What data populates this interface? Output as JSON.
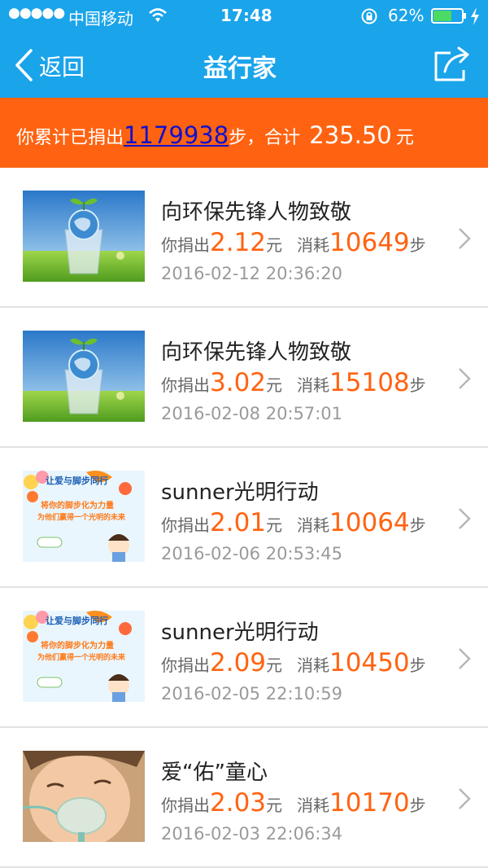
{
  "status_bar": {
    "signal_dots": "●●●●●",
    "carrier": "中国移动",
    "time": "17:48",
    "battery": "62%"
  },
  "nav": {
    "back_label": "返回",
    "title": "益行家"
  },
  "summary": {
    "prefix": "你累计已捐出",
    "steps": "1179938",
    "middle": "步，合计",
    "amount": "235.50",
    "suffix": "元"
  },
  "colors": {
    "nav_blue": "#1aa4ea",
    "accent_orange": "#ff6311",
    "battery_green": "#4cd964"
  },
  "donations": [
    {
      "title": "向环保先锋人物致敬",
      "donate_label": "你捐出",
      "amount": "2.12",
      "amount_unit": "元",
      "consume_label": "消耗",
      "steps": "10649",
      "steps_unit": "步",
      "datetime": "2016-02-12 20:36:20",
      "thumb": "earth-glass-thumbnail"
    },
    {
      "title": "向环保先锋人物致敬",
      "donate_label": "你捐出",
      "amount": "3.02",
      "amount_unit": "元",
      "consume_label": "消耗",
      "steps": "15108",
      "steps_unit": "步",
      "datetime": "2016-02-08 20:57:01",
      "thumb": "earth-glass-thumbnail"
    },
    {
      "title": "sunner光明行动",
      "donate_label": "你捐出",
      "amount": "2.01",
      "amount_unit": "元",
      "consume_label": "消耗",
      "steps": "10064",
      "steps_unit": "步",
      "datetime": "2016-02-06 20:53:45",
      "thumb": "sunner-banner-thumbnail",
      "banner_line1": "让爱与脚步同行",
      "banner_line2": "将你的脚步化为力量",
      "banner_line3": "为他们赢得一个光明的未来"
    },
    {
      "title": "sunner光明行动",
      "donate_label": "你捐出",
      "amount": "2.09",
      "amount_unit": "元",
      "consume_label": "消耗",
      "steps": "10450",
      "steps_unit": "步",
      "datetime": "2016-02-05 22:10:59",
      "thumb": "sunner-banner-thumbnail",
      "banner_line1": "让爱与脚步同行",
      "banner_line2": "将你的脚步化为力量",
      "banner_line3": "为他们赢得一个光明的未来"
    },
    {
      "title": "爱“佑”童心",
      "donate_label": "你捐出",
      "amount": "2.03",
      "amount_unit": "元",
      "consume_label": "消耗",
      "steps": "10170",
      "steps_unit": "步",
      "datetime": "2016-02-03 22:06:34",
      "thumb": "baby-mask-thumbnail"
    }
  ]
}
